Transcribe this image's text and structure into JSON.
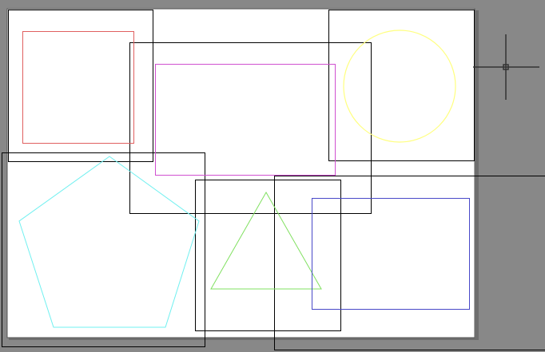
{
  "canvas": {
    "background": "#888888",
    "paper_color": "#ffffff",
    "viewport_color": "#000000"
  },
  "shapes": [
    {
      "type": "rectangle",
      "color": "#e06060"
    },
    {
      "type": "rectangle",
      "color": "#d050d0"
    },
    {
      "type": "circle",
      "color": "#ffff80"
    },
    {
      "type": "pentagon",
      "color": "#70f0f0"
    },
    {
      "type": "triangle",
      "color": "#80e060"
    },
    {
      "type": "rectangle",
      "color": "#4848c8"
    }
  ],
  "cursor": {
    "icon": "crosshair-icon",
    "color": "#333333"
  }
}
